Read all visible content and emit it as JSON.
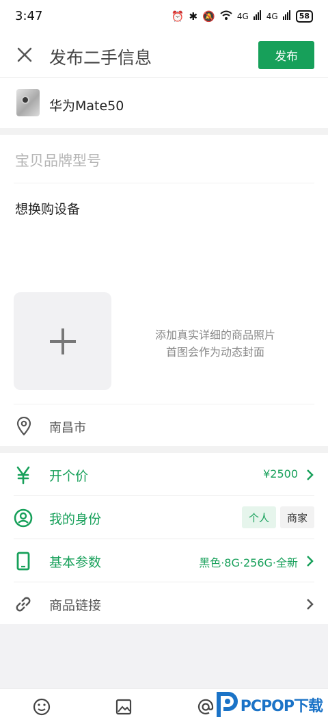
{
  "status_bar": {
    "time": "3:47",
    "net1": "4G",
    "net2": "4G",
    "battery": "58"
  },
  "header": {
    "title": "发布二手信息",
    "publish_label": "发布"
  },
  "product": {
    "name": "华为Mate50"
  },
  "form": {
    "brand_placeholder": "宝贝品牌型号",
    "description": "想换购设备",
    "photo_hint_line1": "添加真实详细的商品照片",
    "photo_hint_line2": "首图会作为动态封面",
    "location": "南昌市"
  },
  "rows": {
    "price_label": "开个价",
    "price_value": "¥2500",
    "identity_label": "我的身份",
    "identity_personal": "个人",
    "identity_business": "商家",
    "params_label": "基本参数",
    "params_value": "黑色·8G·256G·全新",
    "link_label": "商品链接"
  },
  "watermark": {
    "text": "PCPOP下载"
  },
  "colors": {
    "accent": "#17a05a",
    "divider": "#f2f2f2"
  },
  "icons": [
    "close-icon",
    "location-pin-icon",
    "yuan-icon",
    "user-circle-icon",
    "phone-icon",
    "link-icon",
    "chevron-right-icon",
    "emoji-icon",
    "image-icon",
    "at-icon"
  ]
}
